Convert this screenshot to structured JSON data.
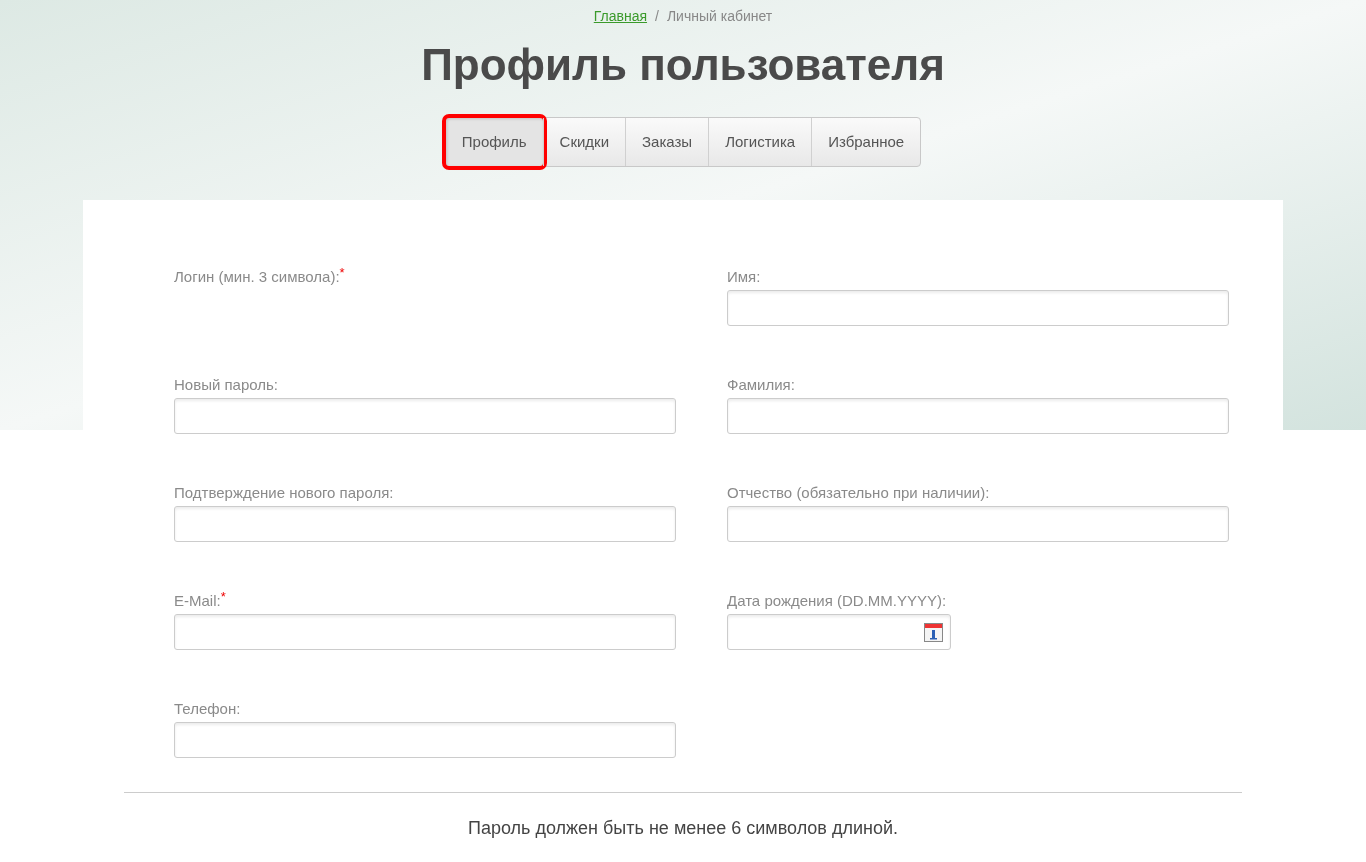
{
  "breadcrumbs": [
    {
      "label": "Главная",
      "link": true
    },
    {
      "label": "/",
      "link": false
    },
    {
      "label": "Личный кабинет",
      "link": false
    }
  ],
  "title": "Профиль пользователя",
  "tabs": [
    {
      "label": "Профиль",
      "selected": true,
      "highlighted": true
    },
    {
      "label": "Скидки",
      "selected": false,
      "highlighted": false
    },
    {
      "label": "Заказы",
      "selected": false,
      "highlighted": false
    },
    {
      "label": "Логистика",
      "selected": false,
      "highlighted": false
    },
    {
      "label": "Избранное",
      "selected": false,
      "highlighted": false
    }
  ],
  "left_fields": [
    {
      "label": "Логин (мин. 3 символа):",
      "required_mark": "*",
      "kind": "static"
    },
    {
      "label": "Новый пароль:",
      "kind": "text"
    },
    {
      "label": "Подтверждение нового пароля:",
      "kind": "text"
    },
    {
      "label": "E-Mail:",
      "required_mark": "*",
      "kind": "text"
    },
    {
      "label": "Телефон:",
      "kind": "text"
    }
  ],
  "right_fields": [
    {
      "label": "Имя:",
      "kind": "text"
    },
    {
      "label": "Фамилия:",
      "kind": "text"
    },
    {
      "label": "Отчество (обязательно при наличии):",
      "kind": "text"
    },
    {
      "label": "Дата рождения (DD.MM.YYYY):",
      "kind": "date"
    }
  ],
  "note": "Пароль должен быть не менее 6 символов длиной."
}
